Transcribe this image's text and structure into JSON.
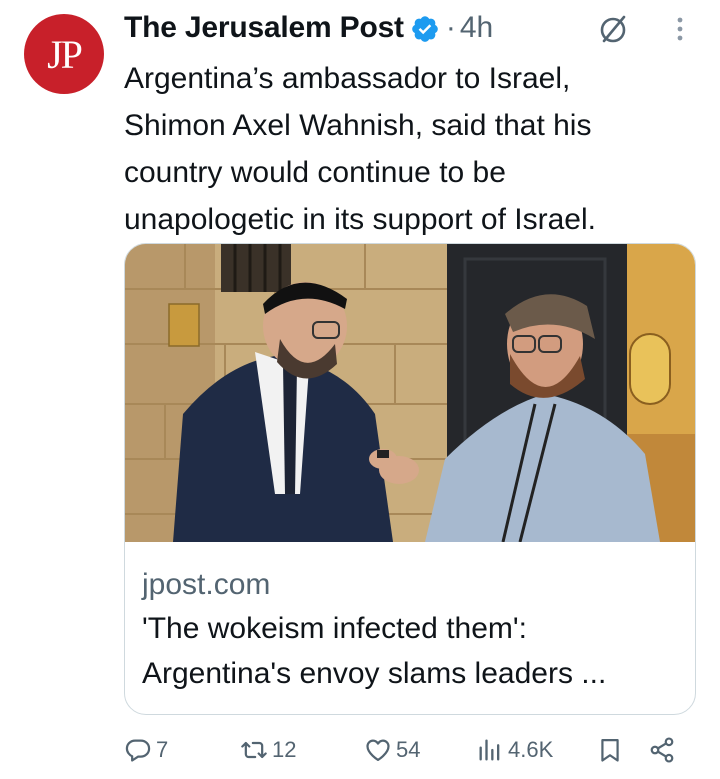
{
  "post": {
    "author_name": "The Jerusalem Post",
    "avatar_text": "JP",
    "separator": "·",
    "time": "4h",
    "text_lines": [
      "Argentina’s ambassador to Israel,",
      "Shimon Axel Wahnish, said that his",
      "country would continue to be",
      "unapologetic in its support of Israel."
    ]
  },
  "card": {
    "domain": "jpost.com",
    "title_lines": [
      "'The wokeism infected them':",
      "Argentina's envoy slams leaders ..."
    ]
  },
  "actions": {
    "replies": "7",
    "reposts": "12",
    "likes": "54",
    "views": "4.6K"
  },
  "icons": {
    "verified": "verified-badge-icon",
    "grok": "grok-icon",
    "more": "more-icon",
    "reply": "reply-icon",
    "repost": "repost-icon",
    "like": "heart-icon",
    "views": "views-chart-icon",
    "bookmark": "bookmark-icon",
    "share": "share-icon"
  },
  "colors": {
    "brand_red": "#c8202a",
    "verified_blue": "#1d9bf0",
    "secondary_text": "#536471",
    "primary_text": "#0f1419",
    "border": "#cfd9de"
  }
}
